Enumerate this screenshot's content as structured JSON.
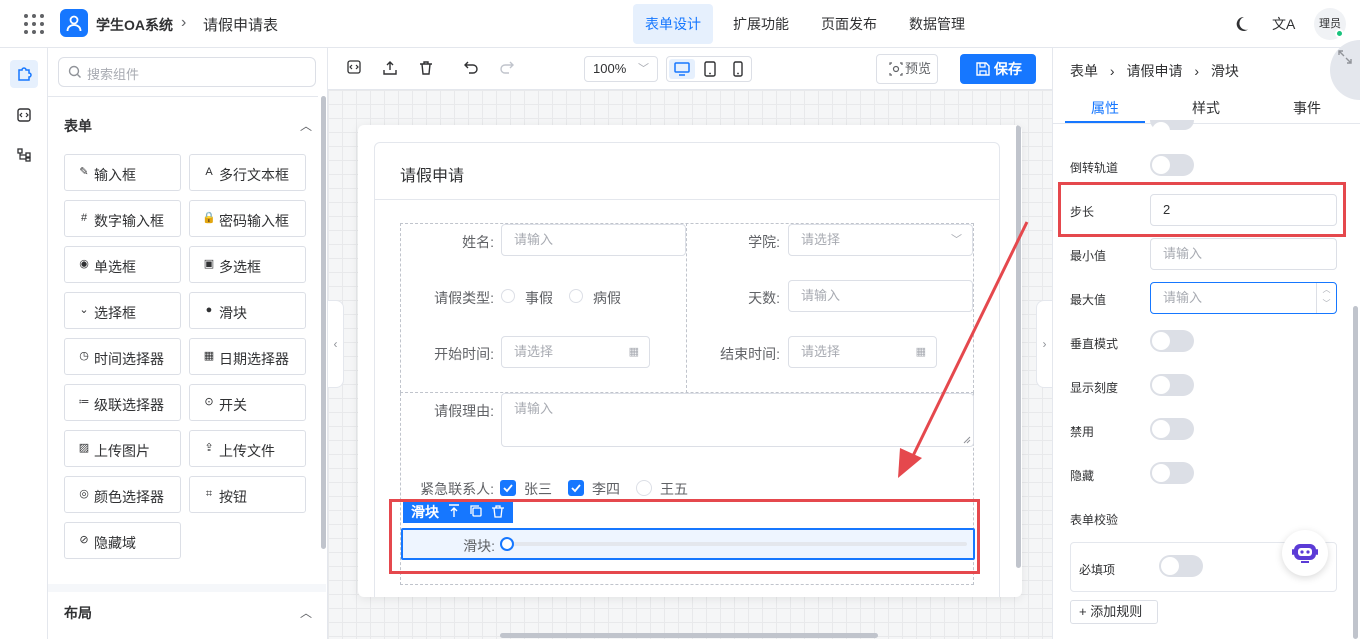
{
  "header": {
    "app_name": "学生OA系统",
    "crumb_sep": "›",
    "page_name": "请假申请表",
    "nav": [
      "表单设计",
      "扩展功能",
      "页面发布",
      "数据管理"
    ],
    "translate_glyph": "文A",
    "avatar_text": "理员"
  },
  "components": {
    "search_placeholder": "搜索组件",
    "section_form": "表单",
    "section_layout": "布局",
    "items": [
      {
        "label": "输入框",
        "icon": "pencil-icon",
        "glyph": "✎"
      },
      {
        "label": "多行文本框",
        "icon": "textarea-icon",
        "glyph": "A"
      },
      {
        "label": "数字输入框",
        "icon": "number-icon",
        "glyph": "#"
      },
      {
        "label": "密码输入框",
        "icon": "lock-icon",
        "glyph": "🔒"
      },
      {
        "label": "单选框",
        "icon": "radio-icon",
        "glyph": "◉"
      },
      {
        "label": "多选框",
        "icon": "checkbox-icon",
        "glyph": "▣"
      },
      {
        "label": "选择框",
        "icon": "select-icon",
        "glyph": "⌄"
      },
      {
        "label": "滑块",
        "icon": "slider-icon",
        "glyph": "●"
      },
      {
        "label": "时间选择器",
        "icon": "clock-icon",
        "glyph": "◷"
      },
      {
        "label": "日期选择器",
        "icon": "calendar-icon",
        "glyph": "▦"
      },
      {
        "label": "级联选择器",
        "icon": "cascader-icon",
        "glyph": "≔"
      },
      {
        "label": "开关",
        "icon": "switch-icon",
        "glyph": "⊙"
      },
      {
        "label": "上传图片",
        "icon": "image-icon",
        "glyph": "▨"
      },
      {
        "label": "上传文件",
        "icon": "upload-icon",
        "glyph": "⇪"
      },
      {
        "label": "颜色选择器",
        "icon": "palette-icon",
        "glyph": "◎"
      },
      {
        "label": "按钮",
        "icon": "button-icon",
        "glyph": "⌗"
      },
      {
        "label": "隐藏域",
        "icon": "eye-off-icon",
        "glyph": "⊘"
      }
    ]
  },
  "toolbar": {
    "zoom": "100%",
    "preview": "预览",
    "save": "保存"
  },
  "form": {
    "title": "请假申请",
    "name_label": "姓名:",
    "name_placeholder": "请输入",
    "college_label": "学院:",
    "college_placeholder": "请选择",
    "type_label": "请假类型:",
    "type_options": [
      "事假",
      "病假"
    ],
    "days_label": "天数:",
    "days_placeholder": "请输入",
    "start_label": "开始时间:",
    "start_placeholder": "请选择",
    "end_label": "结束时间:",
    "end_placeholder": "请选择",
    "reason_label": "请假理由:",
    "reason_placeholder": "请输入",
    "contact_label": "紧急联系人:",
    "contacts": [
      {
        "name": "张三",
        "checked": true
      },
      {
        "name": "李四",
        "checked": true
      },
      {
        "name": "王五",
        "checked": false
      }
    ],
    "slider_tag": "滑块",
    "slider_label": "滑块:"
  },
  "props": {
    "crumb": [
      "表单",
      "请假申请",
      "滑块"
    ],
    "crumb_sep": "›",
    "tabs": [
      "属性",
      "样式",
      "事件"
    ],
    "rows": {
      "reverse_track": "倒转轨道",
      "step_label": "步长",
      "step_value": "2",
      "min_label": "最小值",
      "min_placeholder": "请输入",
      "max_label": "最大值",
      "max_placeholder": "请输入",
      "vertical": "垂直模式",
      "show_ticks": "显示刻度",
      "disabled": "禁用",
      "hidden": "隐藏",
      "validation": "表单校验",
      "required": "必填项",
      "add_rule": "+ 添加规则"
    }
  },
  "colors": {
    "primary": "#1677ff",
    "highlight": "#e5484d"
  }
}
